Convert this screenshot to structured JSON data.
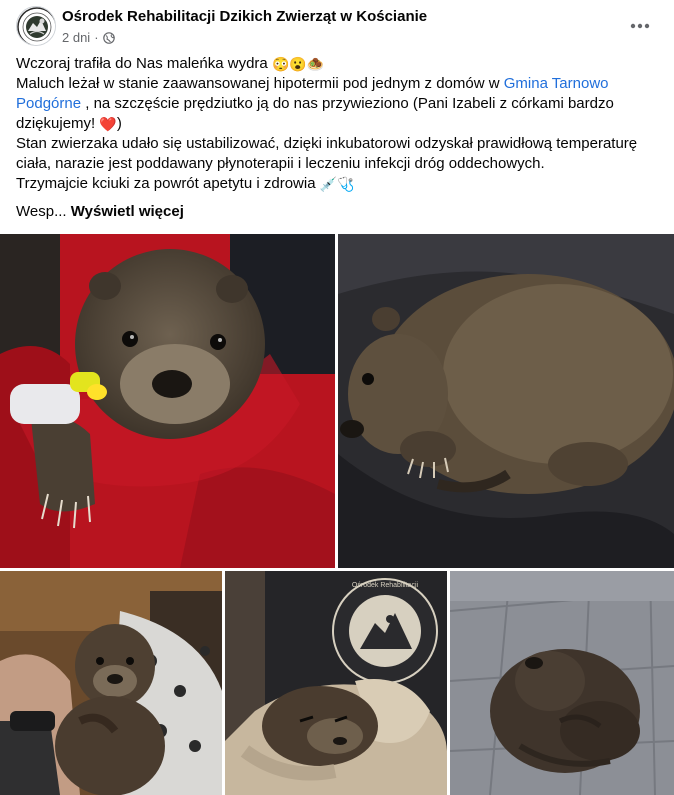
{
  "post": {
    "page_name": "Ośrodek Rehabilitacji Dzikich Zwierząt w Kościanie",
    "time": "2 dni",
    "separator": "·",
    "privacy_icon": "globe-icon",
    "more_icon": "more-options-icon"
  },
  "body": {
    "line1": "Wczoraj trafiła do Nas maleńka wydra",
    "line1_emojis": "😳😮🧆",
    "line2_before": "Maluch leżał w stanie zaawansowanej hipotermii pod jednym z domów w ",
    "line2_link": "Gmina Tarnowo Podgórne",
    "line2_after": " , na szczęście prędziutko ją do nas przywieziono (Pani Izabeli z córkami bardzo dziękujemy!",
    "line2_emoji": "❤️",
    "line2_end": ")",
    "line3": "Stan zwierzaka udało się ustabilizować, dzięki inkubatorowi odzyskał prawidłową temperaturę ciała, narazie jest poddawany płynoterapii i leczeniu infekcji dróg oddechowych.",
    "line4": "Trzymajcie kciuki za powrót apetytu i zdrowia",
    "line4_emojis": "💉🩺",
    "truncated": "Wesp...",
    "see_more": "Wyświetl więcej"
  },
  "photos": {
    "badge_text": "Ośrodek Rehabilitacji Dzikich Zwierząt · Kościanie · Rehabilitacja"
  },
  "colors": {
    "link": "#216fdb",
    "secondary_text": "#65676b",
    "primary_text": "#050505"
  }
}
